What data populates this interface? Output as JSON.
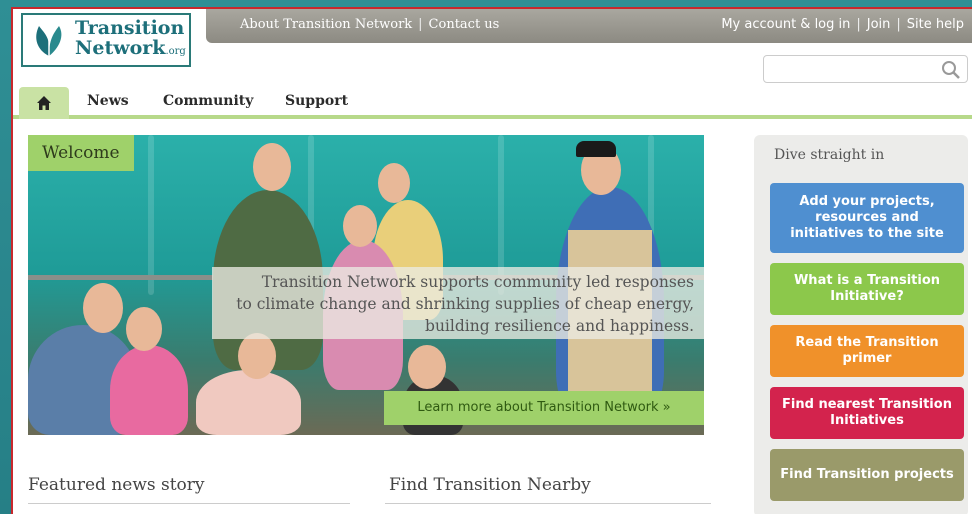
{
  "header": {
    "logo_line1": "Transition",
    "logo_line2": "Network",
    "logo_suffix": ".org",
    "top_left_links": [
      "About Transition Network",
      "Contact us"
    ],
    "top_right_links": [
      "My account & log in",
      "Join",
      "Site help"
    ],
    "separator": "|"
  },
  "search": {
    "value": "",
    "placeholder": ""
  },
  "nav": {
    "home_icon": "home-icon",
    "items": [
      "News",
      "Community",
      "Support"
    ]
  },
  "hero": {
    "welcome_label": "Welcome",
    "tagline_line1": "Transition Network supports community led responses",
    "tagline_line2": "to climate change and shrinking supplies of cheap energy,",
    "tagline_line3": "building resilience and happiness.",
    "learn_more": "Learn more about Transition Network »"
  },
  "sidebar": {
    "title": "Dive straight in",
    "buttons": [
      {
        "label": "Add your projects, resources and initiatives to the site",
        "color": "#4f8fd0"
      },
      {
        "label": "What is a Transition Initiative?",
        "color": "#8cc84b"
      },
      {
        "label": "Read the Transition primer",
        "color": "#f0912a"
      },
      {
        "label": "Find nearest Transition Initiatives",
        "color": "#d3234d"
      },
      {
        "label": "Find Transition projects",
        "color": "#9a9a6a"
      }
    ]
  },
  "sections": {
    "featured": "Featured news story",
    "nearby": "Find Transition Nearby"
  },
  "colors": {
    "frame": "#2c8d94",
    "nav_accent": "#b7d98a",
    "welcome_green": "#9fd16a",
    "topbar_grey": "#9a988f"
  }
}
